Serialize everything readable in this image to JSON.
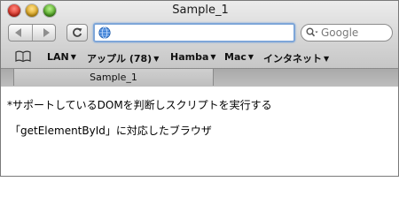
{
  "window": {
    "title": "Sample_1"
  },
  "toolbar": {
    "url_value": "",
    "search_placeholder": "Google"
  },
  "bookmarks": {
    "items": [
      {
        "label": "LAN"
      },
      {
        "label": "アップル (78)"
      },
      {
        "label": "Hamba"
      },
      {
        "label": "Mac"
      },
      {
        "label": "インタネット"
      }
    ]
  },
  "tabs": [
    {
      "label": "Sample_1"
    }
  ],
  "content": {
    "line1": "*サポートしているDOMを判断しスクリプトを実行する",
    "line2": "「getElementById」に対応したブラウザ"
  },
  "colors": {
    "url_focus": "#7ea6d8",
    "close_button": "#d62a1e",
    "minimize_button": "#d8a116",
    "zoom_button": "#4aa21e"
  }
}
